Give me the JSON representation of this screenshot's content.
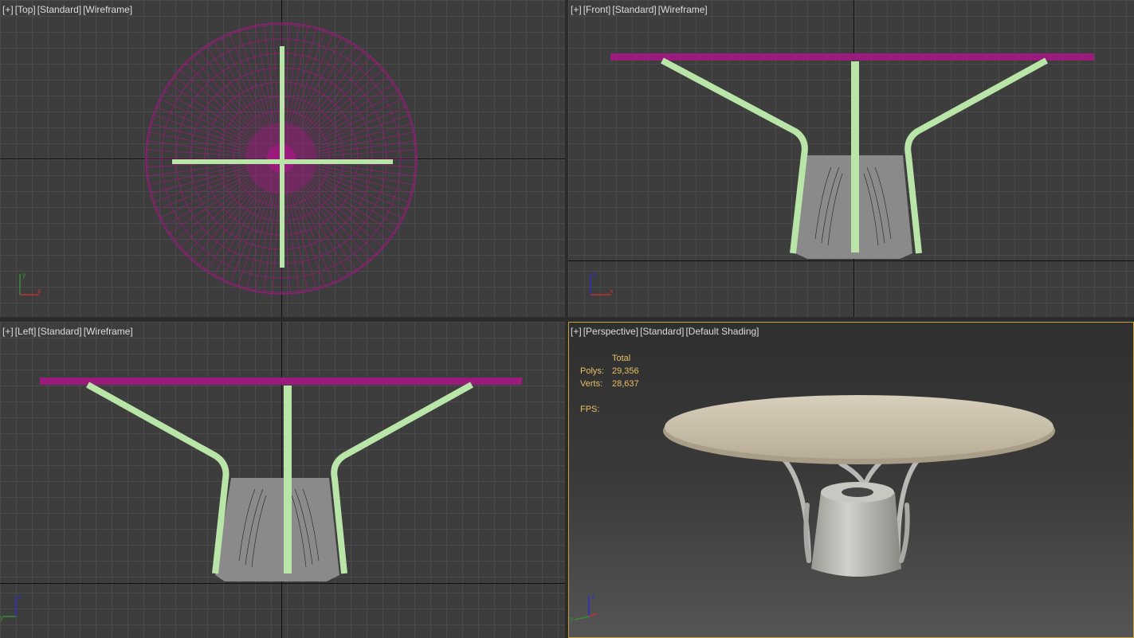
{
  "viewports": {
    "top": {
      "tags": [
        "[+]",
        "[Top]",
        "[Standard]",
        "[Wireframe]"
      ]
    },
    "front": {
      "tags": [
        "[+]",
        "[Front]",
        "[Standard]",
        "[Wireframe]"
      ]
    },
    "left": {
      "tags": [
        "[+]",
        "[Left]",
        "[Standard]",
        "[Wireframe]"
      ]
    },
    "perspective": {
      "tags": [
        "[+]",
        "[Perspective]",
        "[Standard]",
        "[Default Shading]"
      ]
    }
  },
  "stats": {
    "header": "Total",
    "polys_label": "Polys:",
    "polys_value": "29,356",
    "verts_label": "Verts:",
    "verts_value": "28,637",
    "fps_label": "FPS:"
  },
  "gizmo": {
    "x": "x",
    "y": "y",
    "z": "z"
  },
  "colors": {
    "wire_magenta": "#9a1b7c",
    "leg_green": "#b9e6a8",
    "base_gray": "#8a8a8a",
    "active_border": "#c8a040",
    "stats_text": "#e8c060"
  }
}
